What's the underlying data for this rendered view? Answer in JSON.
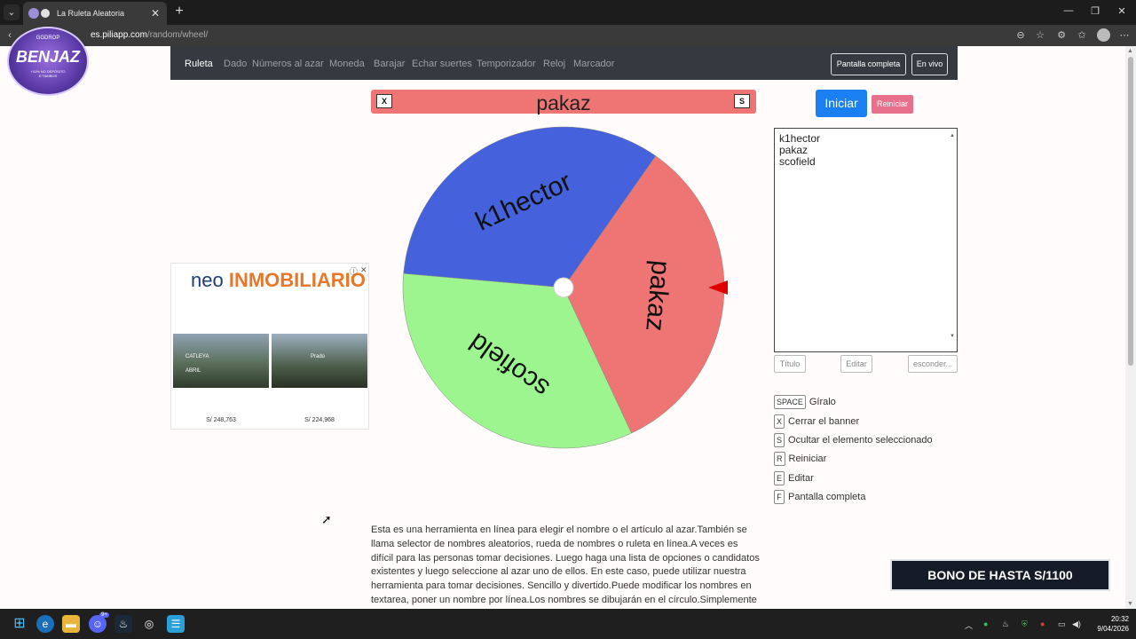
{
  "browser": {
    "tab_title": "La Ruleta Aleatoria",
    "url_domain": "es.piliapp.com",
    "url_path": "/random/wheel/"
  },
  "nav": {
    "items": [
      "Ruleta",
      "Dado",
      "Números al azar",
      "Moneda",
      "Barajar",
      "Echar suertes",
      "Temporizador",
      "Reloj",
      "Marcador"
    ],
    "fullscreen_label": "Pantalla completa",
    "live_label": "En vivo"
  },
  "banner": {
    "close_key": "X",
    "hide_key": "S",
    "selected": "pakaz"
  },
  "wheel": {
    "segments": [
      {
        "label": "k1hector",
        "color": "#4561dc"
      },
      {
        "label": "pakaz",
        "color": "#ef7575"
      },
      {
        "label": "scofield",
        "color": "#9cf58f"
      }
    ],
    "pointer_color": "#e00000"
  },
  "controls": {
    "start_label": "Iniciar",
    "reset_label": "Reiniciar",
    "names_text": "k1hector\npakaz\nscofield",
    "title_btn": "Título",
    "edit_btn": "Editar",
    "hide_btn": "esconder..."
  },
  "shortcuts": [
    {
      "key": "SPACE",
      "label": "Gíralo"
    },
    {
      "key": "X",
      "label": "Cerrar el banner"
    },
    {
      "key": "S",
      "label": "Ocultar el elemento seleccionado"
    },
    {
      "key": "R",
      "label": "Reiniciar"
    },
    {
      "key": "E",
      "label": "Editar"
    },
    {
      "key": "F",
      "label": "Pantalla completa"
    }
  ],
  "description": "Esta es una herramienta en línea para elegir el nombre o el artículo al azar.También se llama selector de nombres aleatorios, rueda de nombres o ruleta en línea.A veces es difícil para las personas tomar decisiones. Luego haga una lista de opciones o candidatos existentes y luego seleccione al azar uno de ellos. En este caso, puede utilizar nuestra herramienta para tomar decisiones. Sencillo y divertido.Puede modificar los nombres en textarea, poner un nombre por línea.Los nombres se dibujarán en el círculo.Simplemente haga clic en la rueda",
  "ad": {
    "logo_prefix": "neo",
    "logo_main": "INMOBILIARIO",
    "photo1_label": "CATLEYA\n\nABRIL",
    "photo2_label": "Prado",
    "price1": "S/ 248,763",
    "price2": "S/ 224,968",
    "info_icon": "ⓘ",
    "close_icon": "✕"
  },
  "overlay": {
    "bono": "BONO DE HASTA S/1100",
    "badge_top": "GGDROP",
    "badge_title": "BENJAZ",
    "badge_small": "+11% NO DEPÓSITO\nE TAMBOS"
  },
  "taskbar": {
    "time": "20:32",
    "date": "9/04/2026",
    "discord_badge": "9+"
  }
}
